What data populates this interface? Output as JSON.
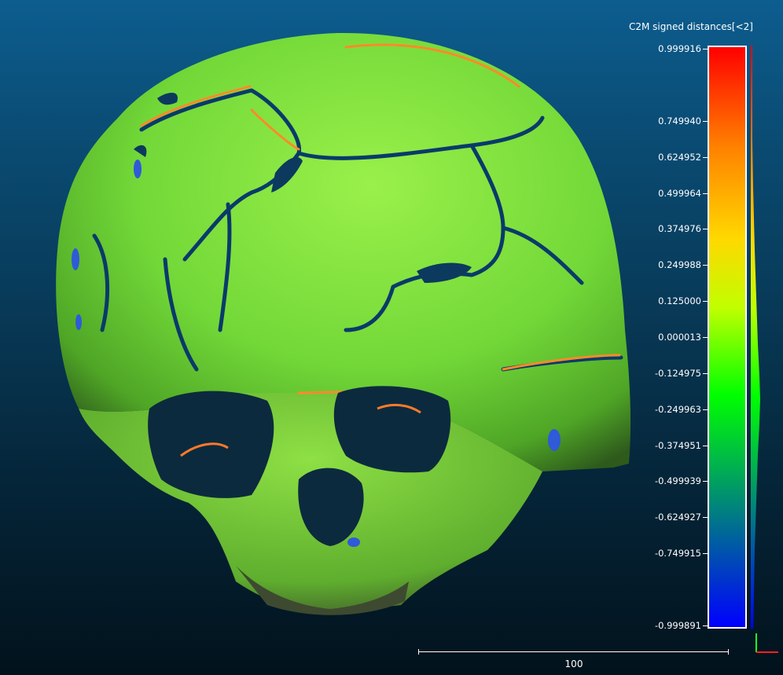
{
  "colorbar": {
    "title": "C2M signed distances[<2]",
    "gradient_colors": [
      "#ff0000",
      "#ff8000",
      "#ffd800",
      "#c0ff00",
      "#00ff00",
      "#00c040",
      "#008080",
      "#0040c0",
      "#0000ff"
    ],
    "ticks": [
      {
        "label": "0.999916",
        "value": 0.999916
      },
      {
        "label": "0.749940",
        "value": 0.74994
      },
      {
        "label": "0.624952",
        "value": 0.624952
      },
      {
        "label": "0.499964",
        "value": 0.499964
      },
      {
        "label": "0.374976",
        "value": 0.374976
      },
      {
        "label": "0.249988",
        "value": 0.249988
      },
      {
        "label": "0.125000",
        "value": 0.125
      },
      {
        "label": "0.000013",
        "value": 1.3e-05
      },
      {
        "label": "-0.124975",
        "value": -0.124975
      },
      {
        "label": "-0.249963",
        "value": -0.249963
      },
      {
        "label": "-0.374951",
        "value": -0.374951
      },
      {
        "label": "-0.499939",
        "value": -0.499939
      },
      {
        "label": "-0.624927",
        "value": -0.624927
      },
      {
        "label": "-0.749915",
        "value": -0.749915
      },
      {
        "label": "-0.999891",
        "value": -0.999891
      }
    ]
  },
  "scale_bar": {
    "label": "100"
  },
  "axes": {
    "x_color": "#ff2020",
    "y_color": "#20ff20"
  },
  "colors": {
    "background_top": "#0d5d8f",
    "background_bottom": "#02121c",
    "model_primary": "#7fe83a"
  }
}
